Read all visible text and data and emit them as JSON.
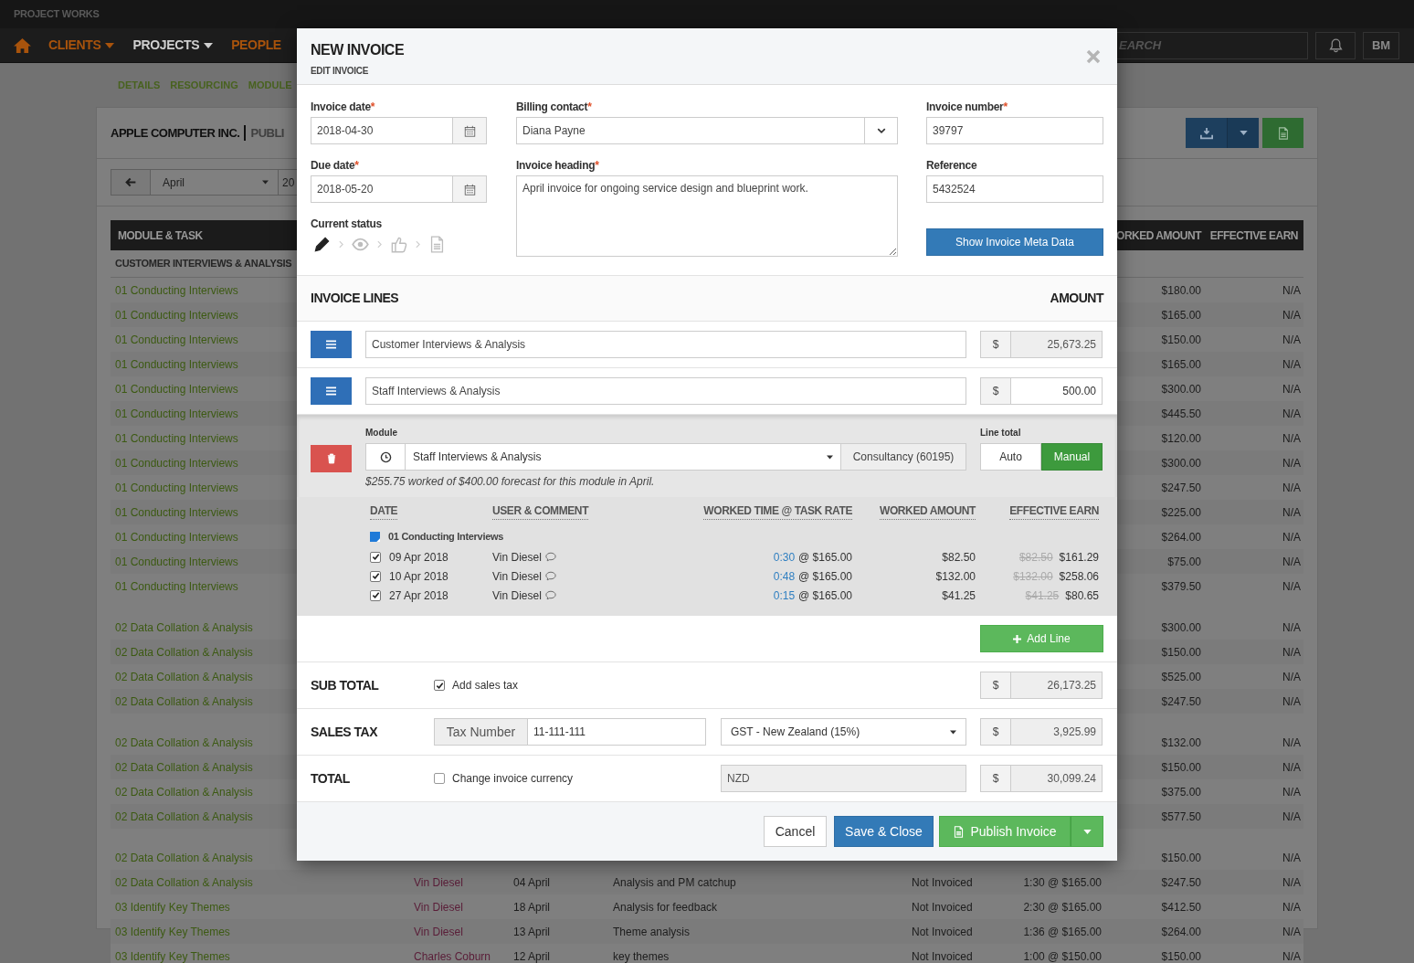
{
  "app": {
    "brand": "PROJECT WORKS",
    "nav": [
      {
        "label": "CLIENTS",
        "selected": false,
        "has_menu": true
      },
      {
        "label": "PROJECTS",
        "selected": true,
        "has_menu": true
      },
      {
        "label": "PEOPLE",
        "selected": false,
        "has_menu": false
      }
    ],
    "search": {
      "placeholder": "EARCH"
    },
    "user_initials": "BM"
  },
  "subtabs": [
    "DETAILS",
    "RESOURCING",
    "MODULE"
  ],
  "page": {
    "title": "APPLE COMPUTER INC.",
    "subtitle": "PUBLI",
    "month": "April",
    "year": "20"
  },
  "table": {
    "columns": {
      "task": "MODULE & TASK",
      "worked_amount": "ORKED AMOUNT",
      "effective_earn": "EFFECTIVE EARN"
    },
    "groups": [
      {
        "heading": "CUSTOMER INTERVIEWS & ANALYSIS",
        "rows": [
          {
            "task": "01 Conducting Interviews",
            "worked_amount": "$180.00",
            "effective_earn": "N/A"
          },
          {
            "task": "01 Conducting Interviews",
            "worked_amount": "$165.00",
            "effective_earn": "N/A"
          },
          {
            "task": "01 Conducting Interviews",
            "worked_amount": "$150.00",
            "effective_earn": "N/A"
          },
          {
            "task": "01 Conducting Interviews",
            "worked_amount": "$165.00",
            "effective_earn": "N/A"
          },
          {
            "task": "01 Conducting Interviews",
            "worked_amount": "$300.00",
            "effective_earn": "N/A"
          },
          {
            "task": "01 Conducting Interviews",
            "worked_amount": "$445.50",
            "effective_earn": "N/A"
          },
          {
            "task": "01 Conducting Interviews",
            "worked_amount": "$120.00",
            "effective_earn": "N/A"
          },
          {
            "task": "01 Conducting Interviews",
            "worked_amount": "$300.00",
            "effective_earn": "N/A"
          },
          {
            "task": "01 Conducting Interviews",
            "worked_amount": "$247.50",
            "effective_earn": "N/A"
          },
          {
            "task": "01 Conducting Interviews",
            "worked_amount": "$225.00",
            "effective_earn": "N/A"
          },
          {
            "task": "01 Conducting Interviews",
            "worked_amount": "$264.00",
            "effective_earn": "N/A"
          },
          {
            "task": "01 Conducting Interviews",
            "worked_amount": "$75.00",
            "effective_earn": "N/A"
          },
          {
            "task": "01 Conducting Interviews",
            "worked_amount": "$379.50",
            "effective_earn": "N/A"
          }
        ]
      },
      {
        "rows": [
          {
            "task": "02 Data Collation & Analysis",
            "worked_amount": "$300.00",
            "effective_earn": "N/A"
          },
          {
            "task": "02 Data Collation & Analysis",
            "worked_amount": "$150.00",
            "effective_earn": "N/A"
          },
          {
            "task": "02 Data Collation & Analysis",
            "worked_amount": "$525.00",
            "effective_earn": "N/A"
          },
          {
            "task": "02 Data Collation & Analysis",
            "worked_amount": "$247.50",
            "effective_earn": "N/A"
          }
        ]
      },
      {
        "rows": [
          {
            "task": "02 Data Collation & Analysis",
            "worked_amount": "$132.00",
            "effective_earn": "N/A"
          },
          {
            "task": "02 Data Collation & Analysis",
            "worked_amount": "$150.00",
            "effective_earn": "N/A"
          },
          {
            "task": "02 Data Collation & Analysis",
            "worked_amount": "$375.00",
            "effective_earn": "N/A"
          },
          {
            "task": "02 Data Collation & Analysis",
            "worked_amount": "$577.50",
            "effective_earn": "N/A"
          }
        ]
      },
      {
        "rows": [
          {
            "task": "02 Data Collation & Analysis",
            "worked_amount": "$150.00",
            "effective_earn": "N/A"
          },
          {
            "task": "02 Data Collation & Analysis",
            "user": "Vin Diesel",
            "date": "04 April",
            "comment": "Analysis and PM catchup",
            "status": "Not Invoiced",
            "time": "1:30 @ $165.00",
            "worked_amount": "$247.50",
            "effective_earn": "N/A"
          },
          {
            "task": "03 Identify Key Themes",
            "user": "Vin Diesel",
            "date": "18 April",
            "comment": "Analysis for feedback",
            "status": "Not Invoiced",
            "time": "2:30 @ $165.00",
            "worked_amount": "$412.50",
            "effective_earn": "N/A"
          },
          {
            "task": "03 Identify Key Themes",
            "user": "Vin Diesel",
            "date": "13 April",
            "comment": "Theme analysis",
            "status": "Not Invoiced",
            "time": "1:36 @ $165.00",
            "worked_amount": "$264.00",
            "effective_earn": "N/A"
          },
          {
            "task": "03 Identify Key Themes",
            "user": "Charles Coburn",
            "date": "12 April",
            "comment": "key themes",
            "status": "Not Invoiced",
            "time": "1:00 @ $150.00",
            "worked_amount": "$150.00",
            "effective_earn": "N/A"
          }
        ]
      }
    ]
  },
  "modal": {
    "title": "NEW INVOICE",
    "subtitle": "EDIT INVOICE",
    "invoice_date": {
      "label": "Invoice date",
      "required_mark": "*",
      "value": "2018-04-30"
    },
    "due_date": {
      "label": "Due date",
      "required_mark": "*",
      "value": "2018-05-20"
    },
    "current_status": {
      "label": "Current status",
      "steps": [
        {
          "kind": "draft",
          "selected": true
        },
        {
          "kind": "viewed",
          "selected": false
        },
        {
          "kind": "approved",
          "selected": false
        },
        {
          "kind": "invoiced",
          "selected": false
        }
      ]
    },
    "billing_contact": {
      "label": "Billing contact",
      "required_mark": "*",
      "value": "Diana Payne"
    },
    "invoice_heading": {
      "label": "Invoice heading",
      "required_mark": "*",
      "value": "April invoice for ongoing service design and blueprint work."
    },
    "invoice_number": {
      "label": "Invoice number",
      "required_mark": "*",
      "value": "39797"
    },
    "reference": {
      "label": "Reference",
      "value": "5432524"
    },
    "meta_button": "Show Invoice Meta Data",
    "lines_heading": "INVOICE LINES",
    "amount_heading": "AMOUNT",
    "lines": [
      {
        "description": "Customer Interviews & Analysis",
        "currency": "$",
        "amount": "25,673.25",
        "readonly": true
      },
      {
        "description": "Staff Interviews & Analysis",
        "currency": "$",
        "amount": "500.00",
        "readonly": false,
        "detail": {
          "module_label": "Module",
          "module": "Staff Interviews & Analysis",
          "account": "Consultancy (60195)",
          "line_total_label": "Line total",
          "modes": [
            {
              "label": "Auto",
              "selected": false
            },
            {
              "label": "Manual",
              "selected": true
            }
          ],
          "note": "$255.75 worked of $400.00 forecast for this module in April.",
          "columns": [
            "DATE",
            "USER & COMMENT",
            "WORKED TIME @ TASK RATE",
            "WORKED AMOUNT",
            "EFFECTIVE EARN"
          ],
          "group": "01 Conducting Interviews",
          "entries": [
            {
              "checked": true,
              "date": "09 Apr 2018",
              "user": "Vin Diesel",
              "time": "0:30",
              "rate": "@ $165.00",
              "amount": "$82.50",
              "original_earn": "$82.50",
              "earn": "$161.29"
            },
            {
              "checked": true,
              "date": "10 Apr 2018",
              "user": "Vin Diesel",
              "time": "0:48",
              "rate": "@ $165.00",
              "amount": "$132.00",
              "original_earn": "$132.00",
              "earn": "$258.06"
            },
            {
              "checked": true,
              "date": "27 Apr 2018",
              "user": "Vin Diesel",
              "time": "0:15",
              "rate": "@ $165.00",
              "amount": "$41.25",
              "original_earn": "$41.25",
              "earn": "$80.65"
            }
          ]
        }
      }
    ],
    "add_line": "Add Line",
    "totals": [
      {
        "kind": "subtotal",
        "label": "SUB TOTAL",
        "option": {
          "label": "Add sales tax",
          "checked": true
        },
        "currency": "$",
        "amount": "26,173.25"
      },
      {
        "kind": "tax",
        "label": "SALES TAX",
        "tax_number_label": "Tax Number",
        "tax_number": "11-111-111",
        "tax_rate": "GST - New Zealand (15%)",
        "currency": "$",
        "amount": "3,925.99"
      },
      {
        "kind": "total",
        "label": "TOTAL",
        "option": {
          "label": "Change invoice currency",
          "checked": false
        },
        "currency_code": "NZD",
        "currency": "$",
        "amount": "30,099.24"
      }
    ],
    "buttons": [
      {
        "kind": "cancel",
        "label": "Cancel"
      },
      {
        "kind": "save",
        "label": "Save & Close"
      },
      {
        "kind": "publish",
        "label": "Publish Invoice"
      }
    ]
  }
}
